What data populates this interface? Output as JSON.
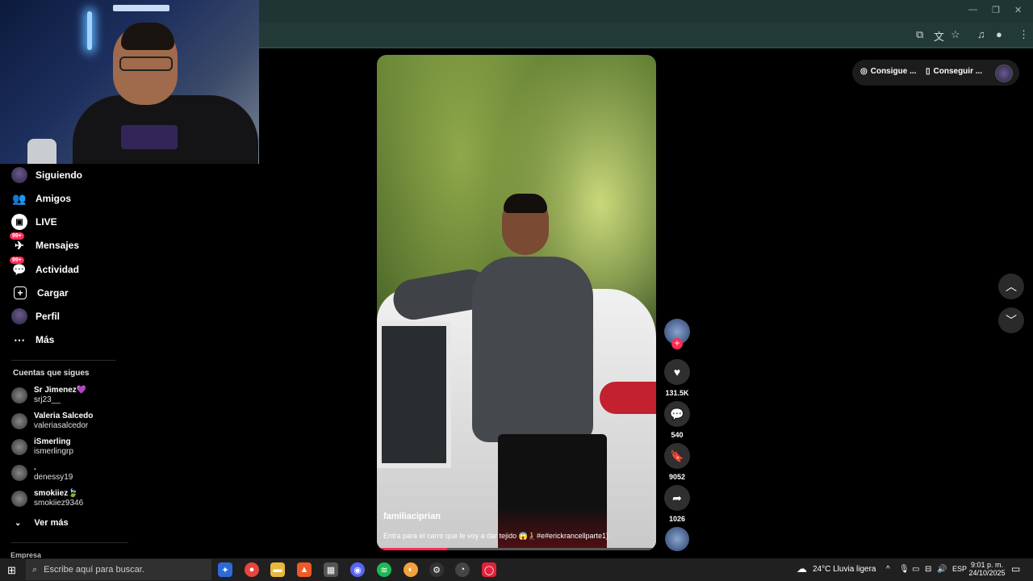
{
  "sidebar": {
    "nav": [
      {
        "label": "Siguiendo",
        "icon": "following-avatar-icon"
      },
      {
        "label": "Amigos",
        "icon": "friends-icon"
      },
      {
        "label": "LIVE",
        "icon": "live-icon"
      },
      {
        "label": "Mensajes",
        "icon": "messages-icon",
        "badge": "99+"
      },
      {
        "label": "Actividad",
        "icon": "activity-icon",
        "badge": "99+"
      },
      {
        "label": "Cargar",
        "icon": "upload-icon"
      },
      {
        "label": "Perfil",
        "icon": "profile-avatar-icon"
      },
      {
        "label": "Más",
        "icon": "more-icon"
      }
    ],
    "following_title": "Cuentas que sigues",
    "accounts": [
      {
        "name": "Sr Jimenez💜",
        "username": "srj23__"
      },
      {
        "name": "Valeria Salcedo",
        "username": "valeriasalcedor"
      },
      {
        "name": "iSmerling",
        "username": "ismerlingrp"
      },
      {
        "name": ".",
        "username": "denessy19"
      },
      {
        "name": "smokiiez🍃",
        "username": "smokiiez9346"
      }
    ],
    "see_more": "Ver más",
    "company": "Empresa"
  },
  "video": {
    "author": "familiaciprian",
    "caption": "Entra para el carro que le voy a dar tejido 😱🧎#e#erickrancellparte1)",
    "progress": 0.25
  },
  "actions": {
    "likes": "131.5K",
    "comments": "540",
    "saves": "9052",
    "shares": "1026"
  },
  "top_right": {
    "btn1": "Consigue ...",
    "btn2": "Conseguir ..."
  },
  "taskbar": {
    "search_placeholder": "Escribe aquí para buscar.",
    "weather": "24°C  Lluvia ligera",
    "lang": "ESP",
    "time": "9:01 p. m.",
    "date": "24/10/2025"
  },
  "colors": {
    "accent": "#fe2c55",
    "chrome": "#223a37"
  }
}
